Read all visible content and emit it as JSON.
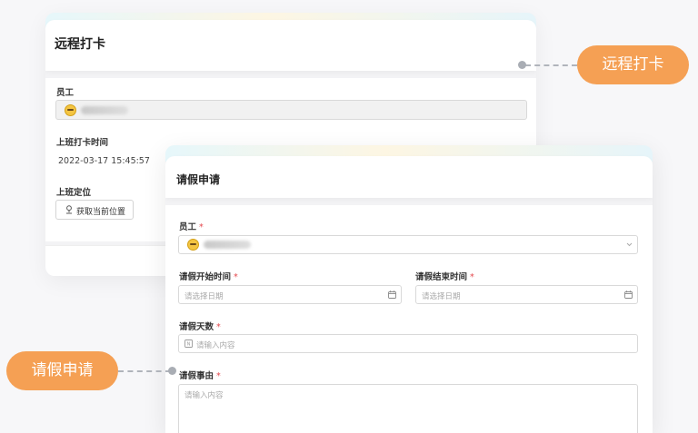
{
  "remote_checkin_card": {
    "title": "远程打卡",
    "employee_label": "员工",
    "checkin_time_label": "上班打卡时间",
    "checkin_time_value": "2022-03-17 15:45:57",
    "location_label": "上班定位",
    "get_location_button": "获取当前位置"
  },
  "leave_request_card": {
    "title": "请假申请",
    "employee_label": "员工",
    "required_mark": "*",
    "start_time_label": "请假开始时间",
    "start_time_placeholder": "请选择日期",
    "end_time_label": "请假结束时间",
    "end_time_placeholder": "请选择日期",
    "days_label": "请假天数",
    "days_placeholder": "请输入内容",
    "reason_label": "请假事由",
    "reason_placeholder": "请输入内容"
  },
  "callouts": {
    "remote_checkin": "远程打卡",
    "leave_request": "请假申请"
  },
  "colors": {
    "accent_orange": "#f5a054",
    "required_red": "#e5484d",
    "connector_gray": "#b0b4bb"
  }
}
